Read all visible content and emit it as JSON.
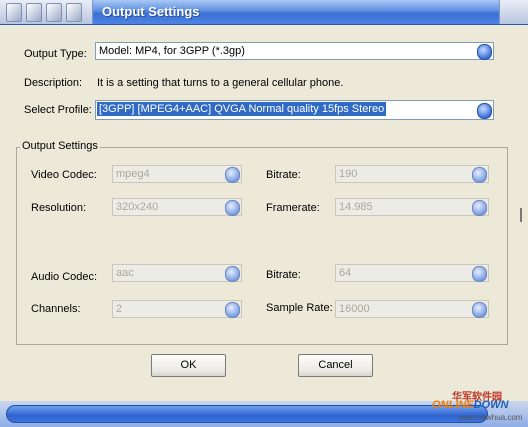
{
  "window": {
    "title": "Output Settings"
  },
  "output_type": {
    "label": "Output Type:",
    "value": "Model: MP4, for 3GPP (*.3gp)"
  },
  "description": {
    "label": "Description:",
    "text": "It is a setting that turns to a general cellular phone."
  },
  "select_profile": {
    "label": "Select Profile:",
    "value": "[3GPP] [MPEG4+AAC] QVGA Normal quality 15fps Stereo"
  },
  "output_settings": {
    "legend": "Output Settings",
    "video_codec": {
      "label": "Video Codec:",
      "value": "mpeg4"
    },
    "video_bitrate": {
      "label": "Bitrate:",
      "value": "190"
    },
    "resolution": {
      "label": "Resolution:",
      "value": "320x240"
    },
    "framerate": {
      "label": "Framerate:",
      "value": "14.985"
    },
    "audio_codec": {
      "label": "Audio Codec:",
      "value": "aac"
    },
    "audio_bitrate": {
      "label": "Bitrate:",
      "value": "64"
    },
    "channels": {
      "label": "Channels:",
      "value": "2"
    },
    "sample_rate": {
      "label": "Sample Rate:",
      "value": "16000"
    }
  },
  "buttons": {
    "ok": "OK",
    "cancel": "Cancel"
  },
  "watermark": {
    "cn": "华军软件园",
    "brand_a": "ONLINE",
    "brand_b": "DOWN",
    "url": "www.newhua.com"
  },
  "colors": {
    "selection": "#316ac5",
    "titlebar": "#3c6fd2"
  }
}
